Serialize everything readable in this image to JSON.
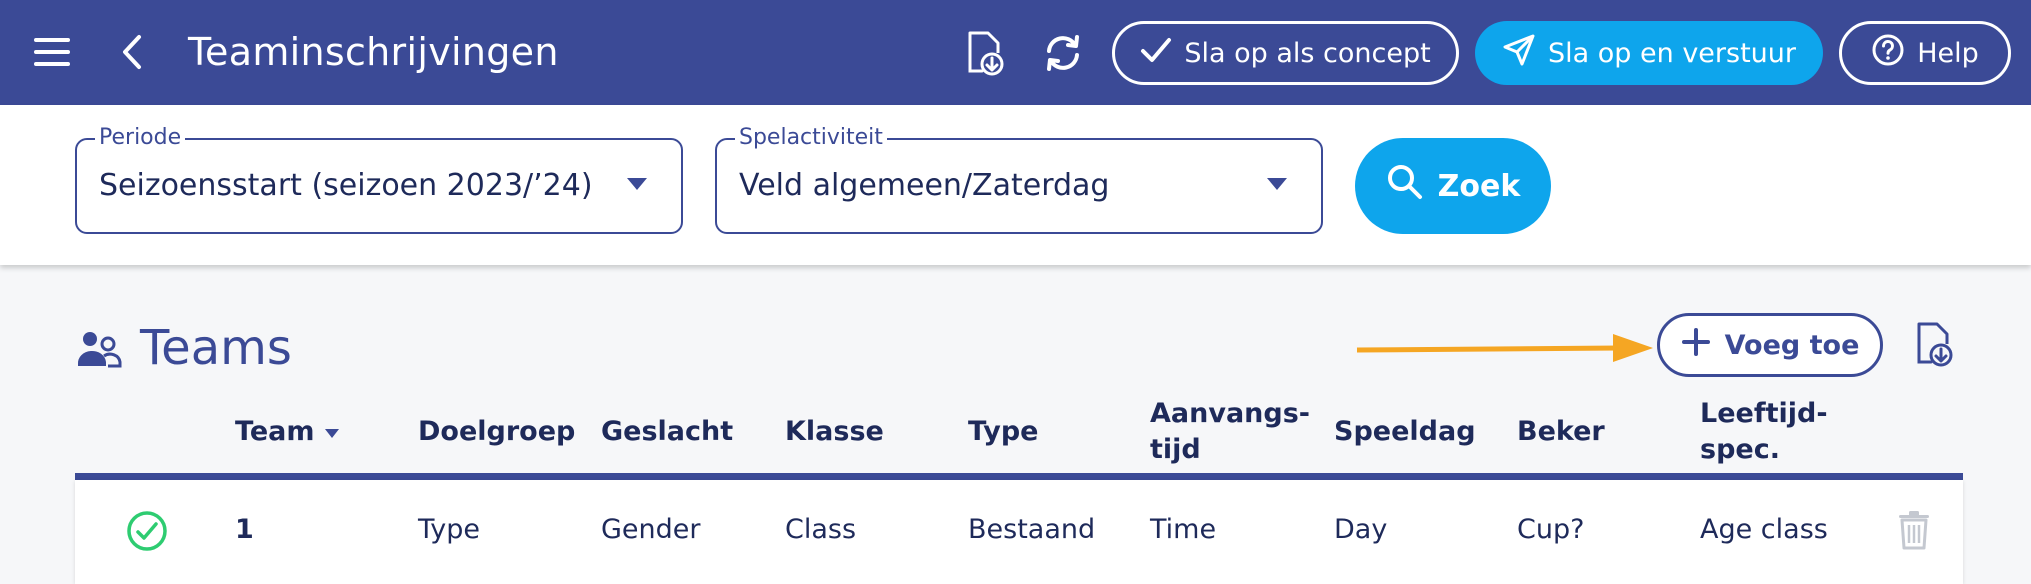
{
  "header": {
    "title": "Teaminschrijvingen",
    "save_concept_label": "Sla op als concept",
    "save_send_label": "Sla op en verstuur",
    "help_label": "Help",
    "icons": [
      "menu-icon",
      "back-icon",
      "export-file-icon",
      "refresh-icon",
      "check-icon",
      "send-icon",
      "help-icon"
    ]
  },
  "filters": {
    "period_label": "Periode",
    "period_value": "Seizoensstart (seizoen 2023/’24)",
    "activity_label": "Spelactiviteit",
    "activity_value": "Veld algemeen/Zaterdag",
    "search_label": "Zoek"
  },
  "teams": {
    "title": "Teams",
    "add_label": "Voeg toe",
    "columns": [
      "Team",
      "Doelgroep",
      "Geslacht",
      "Klasse",
      "Type",
      "Aanvangs-",
      "tijd",
      "Speeldag",
      "Beker",
      "Leeftijd-",
      "spec."
    ],
    "rows": [
      {
        "team": "1",
        "doelgroep": "Type",
        "geslacht": "Gender",
        "klasse": "Class",
        "type": "Bestaand",
        "tijd": "Time",
        "speeldag": "Day",
        "beker": "Cup?",
        "leeftijd": "Age class"
      }
    ]
  },
  "colors": {
    "primary": "#3b4a96",
    "accent": "#0ea5ec",
    "success": "#2ecc71",
    "annotation_arrow": "#f5a623"
  }
}
